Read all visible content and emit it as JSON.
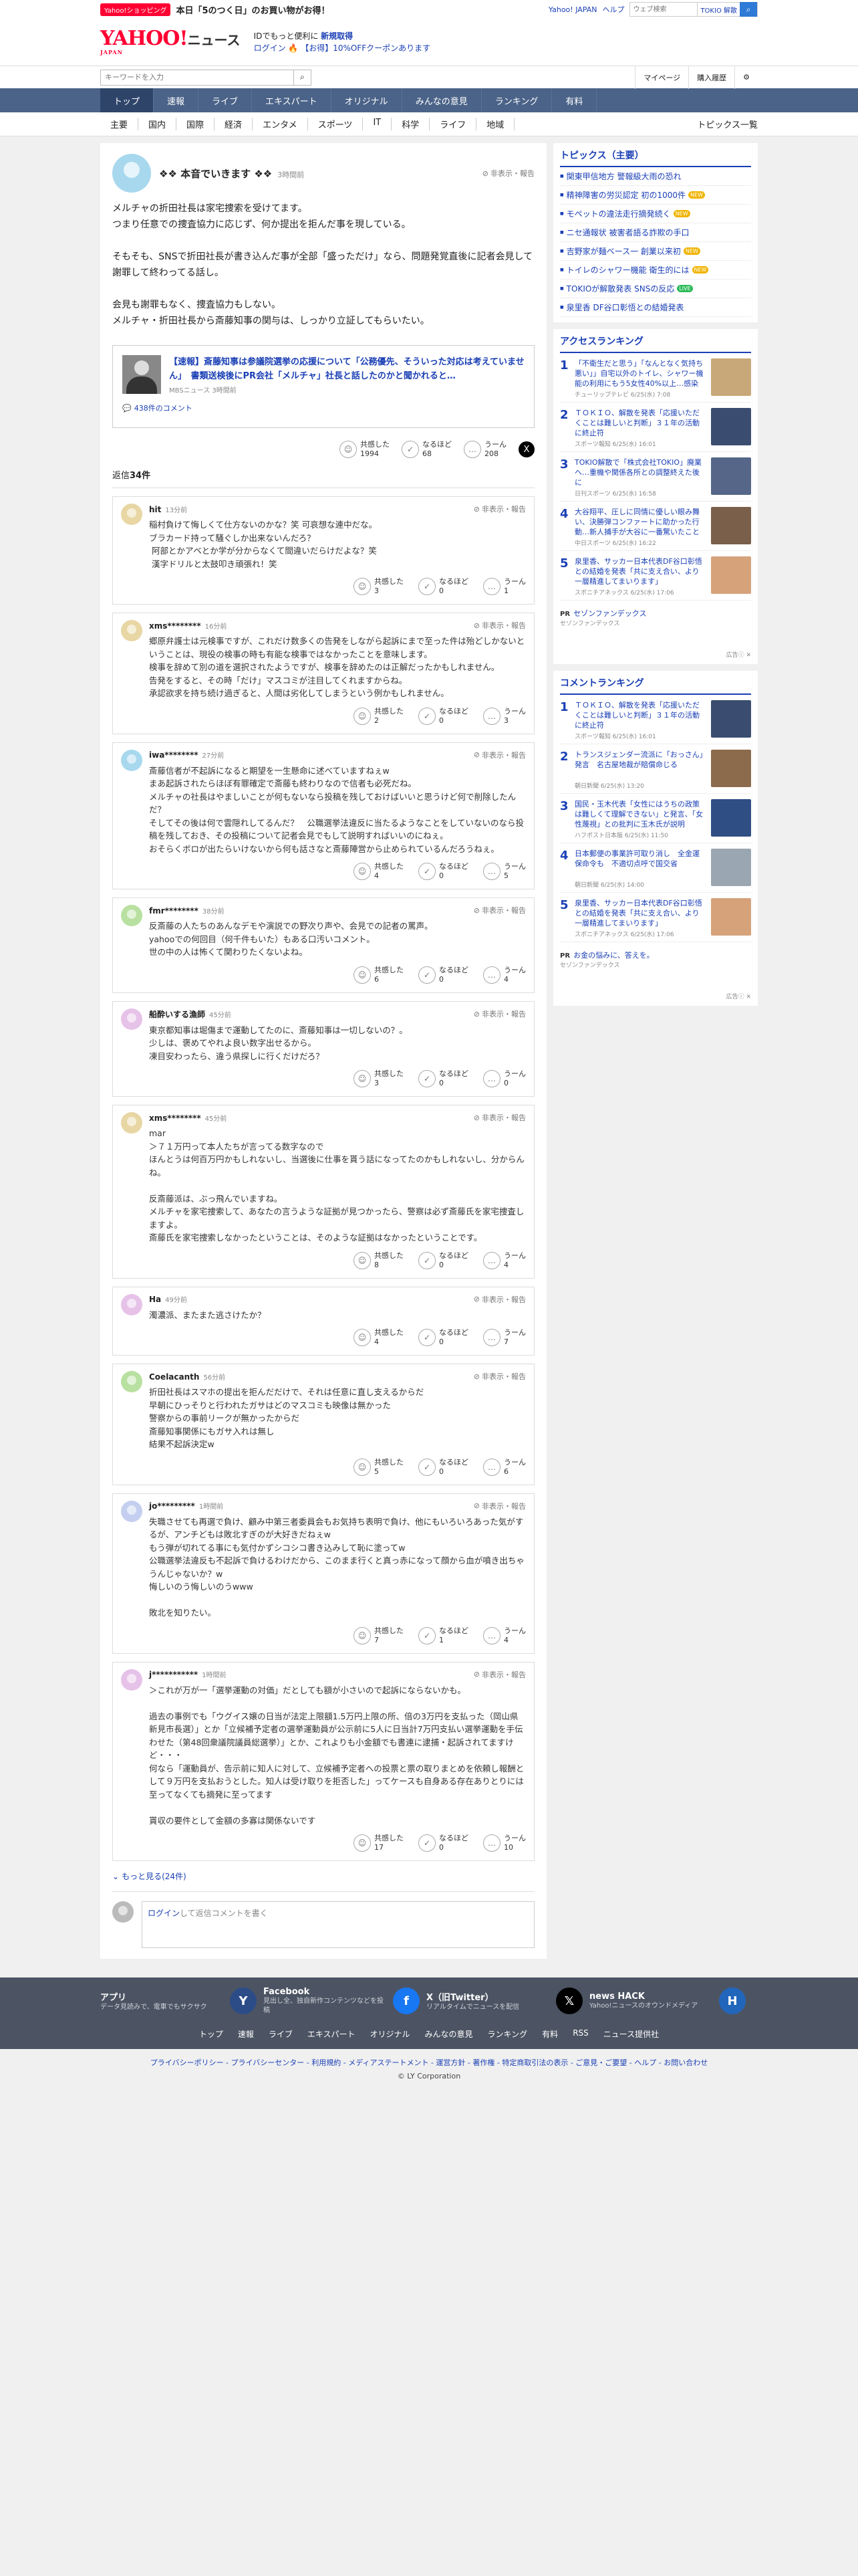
{
  "topbar": {
    "promo_tag": "Yahoo!ショッピング",
    "promo_text": "本日「5のつく日」のお買い物がお得！",
    "links": [
      "Yahoo! JAPAN",
      "ヘルプ"
    ],
    "web_search_placeholder": "ウェブ検索",
    "tokio_label": "TOKIO 解散"
  },
  "header": {
    "logo_main": "YAHOO!",
    "logo_sub": "JAPAN",
    "logo_service": "ニュース",
    "login_line1_pre": "IDでもっと便利に",
    "login_line1_link": "新規取得",
    "login_link": "ログイン",
    "coupon_text": "【お得】10%OFFクーポンあります"
  },
  "search": {
    "placeholder": "キーワードを入力",
    "mypage": "マイページ",
    "history": "購入履歴"
  },
  "nav": {
    "items": [
      "トップ",
      "速報",
      "ライブ",
      "エキスパート",
      "オリジナル",
      "みんなの意見",
      "ランキング",
      "有料"
    ],
    "active": "トップ"
  },
  "subnav": {
    "items": [
      "主要",
      "国内",
      "国際",
      "経済",
      "エンタメ",
      "スポーツ",
      "IT",
      "科学",
      "ライフ",
      "地域"
    ],
    "topics_list": "トピックス一覧"
  },
  "post": {
    "name": "❖❖ 本音でいきます ❖❖",
    "time": "3時間前",
    "report": "非表示・報告",
    "body": "メルチャの折田社長は家宅捜索を受けてます。\nつまり任意での捜査協力に応じず、何か提出を拒んだ事を現している。\n\nそもそも、SNSで折田社長が書き込んだ事が全部「盛っただけ」なら、問題発覚直後に記者会見して謝罪して終わってる話し。\n\n会見も謝罪もなく、捜査協力もしない。\nメルチャ・折田社長から斎藤知事の関与は、しっかり立証してもらいたい。",
    "article_title": "【速報】斎藤知事は参議院選挙の応援について「公務優先、そういった対応は考えていません」　書類送検後にPR会社「メルチャ」社長と話したのかと聞かれると…",
    "article_source": "MBSニュース 3時間前",
    "article_comments": "438件のコメント",
    "reactions": [
      {
        "label": "共感した",
        "count": "1994",
        "icon": "smile"
      },
      {
        "label": "なるほど",
        "count": "68",
        "icon": "idea"
      },
      {
        "label": "うーん",
        "count": "208",
        "icon": "hmm"
      }
    ],
    "share_icon": "X"
  },
  "replies_label": "返信",
  "replies_count": "34件",
  "replies": [
    {
      "name": "hit",
      "time": "13分前",
      "avatar": "#e8d6a4",
      "text": "稲村負けて悔しくて仕方ないのかな？笑 可哀想な連中だな。\nブラカード持って騒ぐしか出来ないんだろ？\n 阿部とかアベとか学が分からなくて間違いだらけだよな？笑\n 漢字ドリルと太鼓叩き頑張れ！笑",
      "r": [
        "3",
        "0",
        "1"
      ]
    },
    {
      "name": "xms********",
      "time": "16分前",
      "avatar": "#e8d6a4",
      "text": "郷原弁護士は元検事ですが、これだけ数多くの告発をしながら起訴にまで至った件は殆どしかないということは、現役の検事の時も有能な検事ではなかったことを意味します。\n検事を辞めて別の道を選択されたようですが、検事を辞めたのは正解だったかもしれません。\n告発をすると、その時「だけ」マスコミが注目してくれますからね。\n承認欲求を持ち続け過ぎると、人間は劣化してしまうという例かもしれません。",
      "r": [
        "2",
        "0",
        "3"
      ]
    },
    {
      "name": "iwa********",
      "time": "27分前",
      "avatar": "#a7d8ee",
      "text": "斎藤信者が不起訴になると期望を一生懸命に述べていますねぇw\nまあ起訴されたらほぼ有罪確定で斎藤も終わりなので信者も必死だね。\nメルチャの社長はやましいことが何もないなら投稿を残しておけばいいと思うけど何で削除したんだ？\nそしてその後は何で雲隠れしてるんだ？　公職選挙法違反に当たるようなことをしていないのなら投稿を残しておき、その投稿について記者会見でもして説明すればいいのにねぇ。\nおそらくボロが出たらいけないから何も話さなと斎藤陣営から止められているんだろうねぇ。",
      "r": [
        "4",
        "0",
        "5"
      ]
    },
    {
      "name": "fmr********",
      "time": "38分前",
      "avatar": "#b8e0a0",
      "text": "反斎藤の人たちのあんなデモや演説での野次り声や、会見での記者の罵声。\nyahooでの何回目（何千件もいた）もある口汚いコメント。\n世の中の人は怖くて関わりたくないよね。",
      "r": [
        "6",
        "0",
        "4"
      ]
    },
    {
      "name": "船酔いする漁師",
      "time": "45分前",
      "avatar": "#e6c2e8",
      "text": "東京都知事は堀傷まで運動してたのに、斎藤知事は一切しないの？。\n少しは、褒めてやれよ良い数字出せるから。\n凍目安わったら、違う県探しに行くだけだろ？",
      "r": [
        "3",
        "0",
        "0"
      ]
    },
    {
      "name": "xms********",
      "time": "45分前",
      "avatar": "#e8d6a4",
      "text": "mar\n＞７１万円って本人たちが言ってる数字なので\nほんとうは何百万円かもしれないし、当選後に仕事を貰う話になってたのかもしれないし、分からんね。\n\n反斎藤派は、ぶっ飛んでいますね。\nメルチャを家宅捜索して、あなたの言うような証拠が見つかったら、警察は必ず斎藤氏を家宅捜査しますよ。\n斎藤氏を家宅捜索しなかったということは、そのような証拠はなかったということです。",
      "r": [
        "8",
        "0",
        "4"
      ]
    },
    {
      "name": "Ha",
      "time": "49分前",
      "avatar": "#e6c2e8",
      "text": "濁濃派、またまた逃さけたか？",
      "r": [
        "4",
        "0",
        "7"
      ]
    },
    {
      "name": "Coelacanth",
      "time": "56分前",
      "avatar": "#b8e0a0",
      "text": "折田社長はスマホの提出を拒んだだけで、それは任意に直し支えるからだ\n早朝にひっそりと行われたガサはどのマスコミも映像は無かった\n警察からの事前リークが無かったからだ\n斎藤知事関係にもガサ入れは無し\n結果不起訴決定w",
      "r": [
        "5",
        "0",
        "6"
      ]
    },
    {
      "name": "jo*********",
      "time": "1時間前",
      "avatar": "#c4cff0",
      "text": "失職させても再選で負け、顧み中第三者委員会もお気持ち表明で負け、他にもいろいろあった気がするが、アンチどもは敗北すぎのが大好きだねぇw\nもう弾が切れてる事にも気付かずシコシコ書き込みして恥に塗ってw\n公職選挙法違反も不起訴で負けるわけだから、このまま行くと真っ赤になって顔から血が噴き出ちゃうんじゃないか？w\n悔しいのう悔しいのうwww\n\n敗北を知りたい。",
      "r": [
        "7",
        "1",
        "4"
      ]
    },
    {
      "name": "j***********",
      "time": "1時間前",
      "avatar": "#e6c2e8",
      "text": "＞これが万が一「選挙運動の対価」だとしても額が小さいので起訴にならないかも。\n\n過去の事例でも「ウグイス嬢の日当が法定上限額1.5万円上限の所、倍の3万円を支払った（岡山県新見市長選）」とか「立候補予定者の選挙運動員が公示前に5人に日当計7万円支払い選挙運動を手伝わせた（第48回衆議院議員総選挙）」とか、これよりも小金額でも書連に逮捕・起訴されてますけど・・・\n何なら「運動員が、告示前に知人に対して、立候補予定者への投票と票の取りまとめを依頼し報酬として９万円を支払おうとした。知人は受け取りを拒否した」ってケースも自身ある存在ありとりには至ってなくても摘発に至ってます\n\n貰収の要件として金額の多寡は関係ないです",
      "r": [
        "17",
        "0",
        "10"
      ]
    }
  ],
  "more_replies": "もっと見る(24件)",
  "compose": {
    "login": "ログイン",
    "text": "して返信コメントを書く"
  },
  "right": {
    "topics_title": "トピックス（主要）",
    "topics": [
      {
        "t": "関東甲信地方 警報級大雨の恐れ",
        "b": ""
      },
      {
        "t": "精神障害の労災認定 初の1000件",
        "b": "NEW"
      },
      {
        "t": "モペットの違法走行摘発続く",
        "b": "NEW"
      },
      {
        "t": "ニセ通報状 被害者語る詐欺の手口",
        "b": ""
      },
      {
        "t": "吉野家が麺ベース一 創業以来初",
        "b": "NEW"
      },
      {
        "t": "トイレのシャワー機能 衛生的には",
        "b": "NEW"
      },
      {
        "t": "TOKIOが解散発表 SNSの反応",
        "b": "LIVE"
      },
      {
        "t": "泉里香 DF谷口彰悟との結婚発表",
        "b": ""
      }
    ],
    "access_title": "アクセスランキング",
    "access": [
      {
        "t": "「不衛生だと思う」「なんとなく気持ち悪い」」自宅以外のトイレ、シャワー機能の利用にもう5女性40%以上…感染リスクはあるの？",
        "s": "チューリップテレビ 6/25(水) 7:08",
        "c": "#c8a878"
      },
      {
        "t": "ＴＯＫＩＯ、解散を発表「応援いただくことは難しいと判断」３１年の活動に終止符",
        "s": "スポーツ報知 6/25(水) 16:01",
        "c": "#3a4d70"
      },
      {
        "t": "TOKIO解散で「株式会社TOKIO」廃業へ…重機や関係各所との調整終えた後に",
        "s": "日刊スポーツ 6/25(水) 16:58",
        "c": "#556688"
      },
      {
        "t": "大谷翔平、圧しに同情に優しい眼み舞い、決勝弾コンファートに助かった行動…新人捕手が大谷に一番驚いたことは",
        "s": "中日スポーツ 6/25(水) 16:22",
        "c": "#7a5f4a"
      },
      {
        "t": "泉里香、サッカー日本代表DF谷口彰悟との結婚を発表「共に支え合い、より一層精進してまいります」",
        "s": "スポニチアネックス 6/25(水) 17:06",
        "c": "#d6a27a"
      }
    ],
    "pr1": {
      "label": "PR",
      "t": "セゾンファンデックス",
      "s": "セゾンファンデックス"
    },
    "ad_icons": "広告ⓘ ✕",
    "comment_title": "コメントランキング",
    "comment_ranks": [
      {
        "t": "ＴＯＫＩＯ、解散を発表「応援いただくことは難しいと判断」３１年の活動に終止符",
        "s": "スポーツ報知 6/25(水) 16:01",
        "c": "#3a4d70"
      },
      {
        "t": "トランスジェンダー流派に「おっさん」発言　名古屋地裁が賠償命じる",
        "s": "朝日新聞 6/25(水) 13:20",
        "c": "#8c6a4c"
      },
      {
        "t": "国民・玉木代表「女性にはうちの政策は難しくて理解できない」と発言、「女性蔑視」との批判に玉木氏が説明",
        "s": "ハフポスト日本版 6/25(水) 11:50",
        "c": "#2f4f84"
      },
      {
        "t": "日本郵便の事業許可取り消し　全金運保命令も　不適切点呼で国交省",
        "s": "朝日新聞 6/25(水) 14:00",
        "c": "#9aa7b3"
      },
      {
        "t": "泉里香、サッカー日本代表DF谷口彰悟との結婚を発表「共に支え合い、より一層精進してまいります」",
        "s": "スポニチアネックス 6/25(水) 17:06",
        "c": "#d6a27a"
      }
    ],
    "pr2": {
      "label": "PR",
      "t": "お金の悩みに、答えを。",
      "s": "セゾンファンデックス"
    }
  },
  "footer": {
    "apps": [
      {
        "t": "アプリ",
        "d": "データ見読みで、電車でもサクサク",
        "c": "#2c4c88",
        "i": "Y"
      },
      {
        "t": "Facebook",
        "d": "見出し全、独自新作コンテンツなどを投稿",
        "c": "#1877f2",
        "i": "f"
      },
      {
        "t": "X（旧Twitter）",
        "d": "リアルタイムでニュースを配信",
        "c": "#000000",
        "i": "𝕏"
      },
      {
        "t": "news HACK",
        "d": "Yahoo!ニュースのオウンドメディア",
        "c": "#2266bb",
        "i": "H"
      }
    ],
    "nav": [
      "トップ",
      "速報",
      "ライブ",
      "エキスパート",
      "オリジナル",
      "みんなの意見",
      "ランキング",
      "有料",
      "RSS",
      "ニュース提供社"
    ],
    "links": "プライバシーポリシー - プライバシーセンター - 利用規約 - メディアステートメント - 運営方針 - 著作権 - 特定商取引法の表示 - ご意見・ご要望 - ヘルプ - お問い合わせ",
    "copyright": "© LY Corporation"
  }
}
